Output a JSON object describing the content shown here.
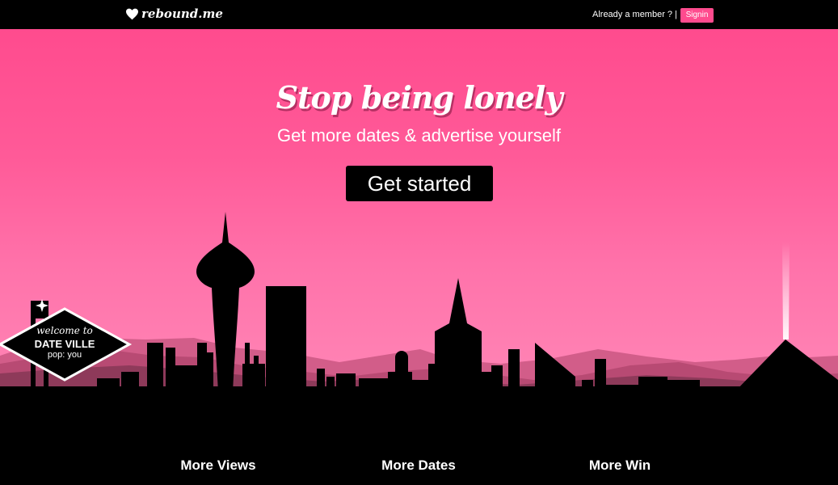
{
  "header": {
    "logo_text": "rebound.me",
    "member_prompt": "Already a member ? |",
    "signin_label": "Signin"
  },
  "hero": {
    "headline": "Stop being lonely",
    "subheadline": "Get more dates & advertise yourself",
    "cta_label": "Get started"
  },
  "sign": {
    "line1": "welcome to",
    "line2": "DATE VILLE",
    "line3": "pop: you"
  },
  "features": [
    {
      "label": "More Views"
    },
    {
      "label": "More Dates"
    },
    {
      "label": "More Win"
    }
  ],
  "colors": {
    "accent": "#ff4b8e",
    "background": "#000000",
    "text": "#ffffff"
  },
  "icons": {
    "logo": "heart-icon"
  }
}
